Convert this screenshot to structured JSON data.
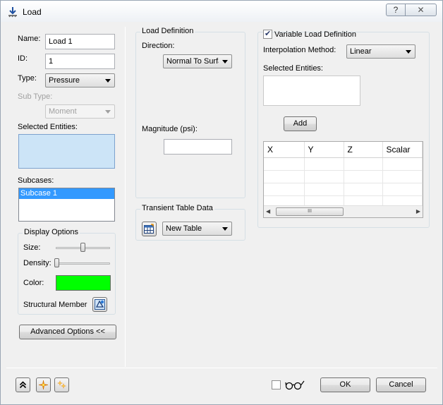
{
  "window": {
    "title": "Load",
    "help_glyph": "?",
    "close_glyph": "✕"
  },
  "left": {
    "name_label": "Name:",
    "name_value": "Load 1",
    "id_label": "ID:",
    "id_value": "1",
    "type_label": "Type:",
    "type_value": "Pressure",
    "subtype_label": "Sub Type:",
    "subtype_value": "Moment",
    "selected_entities_label": "Selected Entities:",
    "subcases_label": "Subcases:",
    "subcases": [
      "Subcase 1"
    ],
    "display_options": {
      "title": "Display Options",
      "size_label": "Size:",
      "size_level": 0.5,
      "density_label": "Density:",
      "density_level": 0.0,
      "color_label": "Color:",
      "color": "#00ff00",
      "structural_member_label": "Structural Member"
    },
    "advanced_button": "Advanced Options <<"
  },
  "load_definition": {
    "title": "Load Definition",
    "direction_label": "Direction:",
    "direction_value": "Normal To Surfa",
    "magnitude_label": "Magnitude (psi):",
    "magnitude_value": ""
  },
  "transient": {
    "title": "Transient Table Data",
    "table_value": "New Table"
  },
  "variable": {
    "checkbox_label": "Variable Load Definition",
    "checked": true,
    "interp_label": "Interpolation Method:",
    "interp_value": "Linear",
    "selected_entities_label": "Selected Entities:",
    "add_button": "Add",
    "columns": [
      "X",
      "Y",
      "Z",
      "Scalar"
    ],
    "scroll_thumb_glyph": "III"
  },
  "footer": {
    "ok": "OK",
    "cancel": "Cancel"
  },
  "colors": {
    "accent": "#3399ff",
    "selection_box": "#cce4f7"
  }
}
